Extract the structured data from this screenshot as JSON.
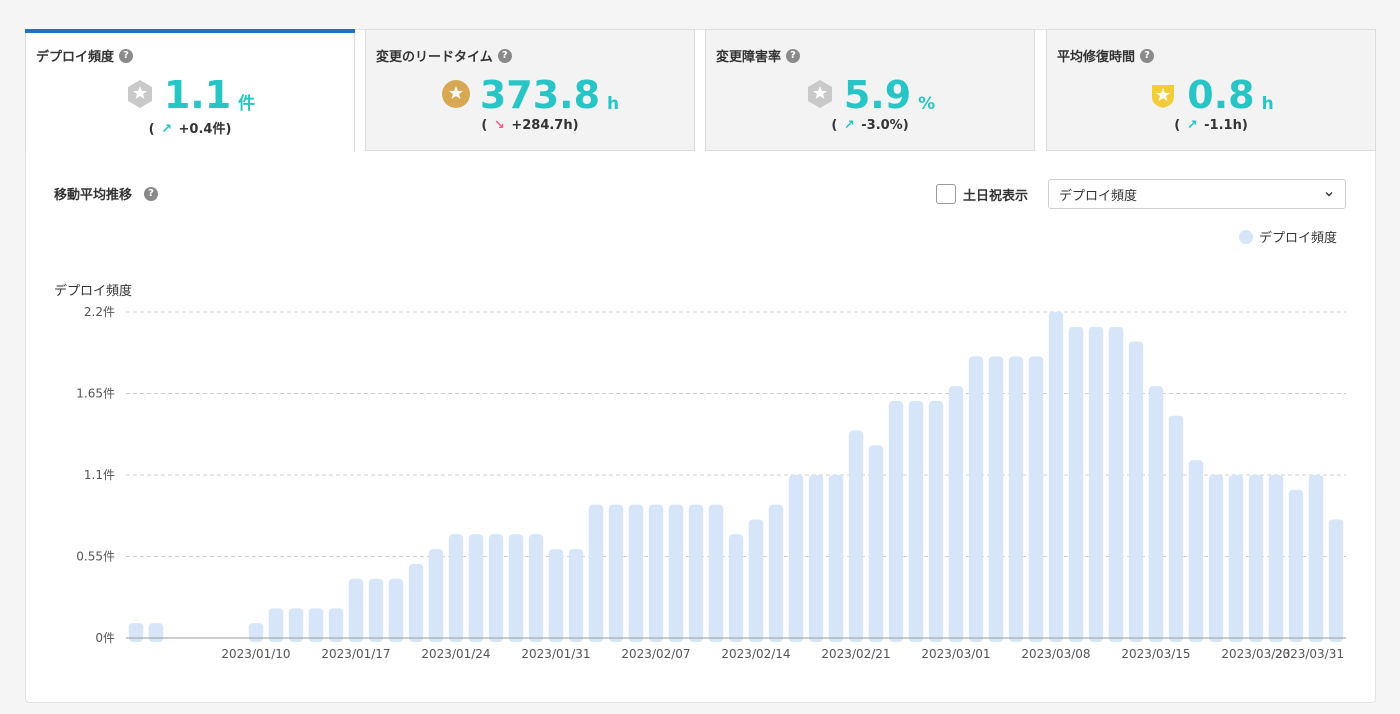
{
  "colors": {
    "accent": "#27c5c5",
    "tab_active": "#1a73c8",
    "bar": "#d6e5f7",
    "down_arrow": "#ef5b86"
  },
  "tabs": [
    {
      "title": "デプロイ頻度",
      "value": "1.1",
      "unit": "件",
      "delta_open": "(",
      "delta_arrow": "up",
      "delta": "+0.4件",
      "delta_close": ")",
      "badge": "silver-badge-icon"
    },
    {
      "title": "変更のリードタイム",
      "value": "373.8",
      "unit": "h",
      "delta_open": "(",
      "delta_arrow": "down",
      "delta": "+284.7h",
      "delta_close": ")",
      "badge": "bronze-badge-icon"
    },
    {
      "title": "変更障害率",
      "value": "5.9",
      "unit": "%",
      "delta_open": "(",
      "delta_arrow": "up",
      "delta": "-3.0%",
      "delta_close": ")",
      "badge": "silver-badge-icon"
    },
    {
      "title": "平均修復時間",
      "value": "0.8",
      "unit": "h",
      "delta_open": "(",
      "delta_arrow": "up",
      "delta": "-1.1h",
      "delta_close": ")",
      "badge": "gold-badge-icon"
    }
  ],
  "help_glyph": "?",
  "section": {
    "title": "移動平均推移",
    "holiday_checkbox_label": "土日祝表示",
    "holiday_checked": false,
    "metric_select_value": "デプロイ頻度"
  },
  "chart_data": {
    "type": "bar",
    "legend": [
      "デプロイ頻度"
    ],
    "legend_position": "top-right",
    "ylabel": "デプロイ頻度",
    "ylim": [
      0,
      2.2
    ],
    "yticks": [
      "0件",
      "0.55件",
      "1.1件",
      "1.65件",
      "2.2件"
    ],
    "ytick_values": [
      0,
      0.55,
      1.1,
      1.65,
      2.2
    ],
    "grid": true,
    "xtick_labels": [
      "2023/01/10",
      "2023/01/17",
      "2023/01/24",
      "2023/01/31",
      "2023/02/07",
      "2023/02/14",
      "2023/02/21",
      "2023/03/01",
      "2023/03/08",
      "2023/03/15",
      "2023/03/23",
      "2023/03/31"
    ],
    "xtick_bar_index": [
      6,
      11,
      16,
      21,
      26,
      31,
      36,
      41,
      46,
      51,
      56,
      61
    ],
    "series": [
      {
        "name": "デプロイ頻度",
        "values": [
          0.1,
          0.1,
          0,
          0,
          0,
          0,
          0.1,
          0.2,
          0.2,
          0.2,
          0.2,
          0.4,
          0.4,
          0.4,
          0.5,
          0.6,
          0.7,
          0.7,
          0.7,
          0.7,
          0.7,
          0.6,
          0.6,
          0.9,
          0.9,
          0.9,
          0.9,
          0.9,
          0.9,
          0.9,
          0.7,
          0.8,
          0.9,
          1.1,
          1.1,
          1.1,
          1.4,
          1.3,
          1.6,
          1.6,
          1.6,
          1.7,
          1.9,
          1.9,
          1.9,
          1.9,
          2.2,
          2.1,
          2.1,
          2.1,
          2.0,
          1.7,
          1.5,
          1.2,
          1.1,
          1.1,
          1.1,
          1.1,
          1.0,
          1.1,
          0.8
        ]
      }
    ]
  }
}
